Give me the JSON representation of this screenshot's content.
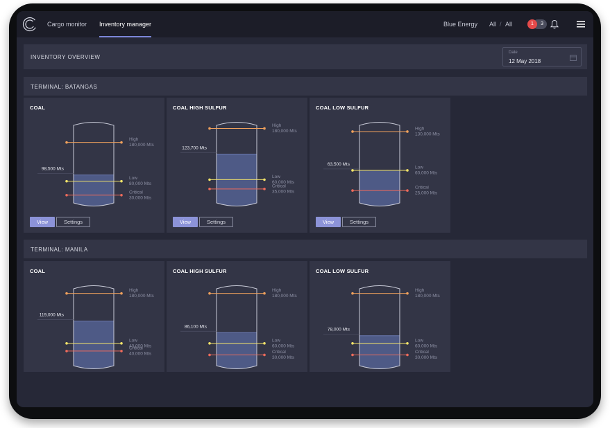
{
  "nav": {
    "tabs": [
      {
        "label": "Cargo monitor"
      },
      {
        "label": "Inventory manager"
      }
    ],
    "company": "Blue Energy",
    "filter_a": "All",
    "filter_sep": "/",
    "filter_b": "All",
    "badge_alerts": "1",
    "badge_count": "3"
  },
  "overview": {
    "title": "INVENTORY OVERVIEW",
    "date_label": "Date",
    "date_value": "12 May 2018"
  },
  "colors": {
    "accent": "#8c93d8",
    "high_line": "#f0a15c",
    "low_line": "#f3e46a",
    "critical_line": "#ee6b5b",
    "fill": "#4e5a86"
  },
  "buttons": {
    "view": "View",
    "settings": "Settings"
  },
  "terminals": [
    {
      "name": "TERMINAL: BATANGAS",
      "cards": [
        {
          "title": "COAL",
          "current": "98,500 Mts",
          "level": 0.36,
          "high_label": "High",
          "high_value": "180,000 Mts",
          "high": 0.78,
          "low_label": "Low",
          "low_value": "80,000 Mts",
          "low": 0.28,
          "critical_label": "Critical",
          "critical_value": "30,000 Mts",
          "critical": 0.1
        },
        {
          "title": "COAL HIGH SULFUR",
          "current": "123,700 Mts",
          "level": 0.63,
          "high_label": "High",
          "high_value": "180,000 Mts",
          "high": 0.96,
          "low_label": "Low",
          "low_value": "60,000 Mts",
          "low": 0.3,
          "critical_label": "Critical",
          "critical_value": "35,000 Mts",
          "critical": 0.18
        },
        {
          "title": "COAL LOW SULFUR",
          "current": "63,500 Mts",
          "level": 0.42,
          "high_label": "High",
          "high_value": "130,000 Mts",
          "high": 0.92,
          "low_label": "Low",
          "low_value": "60,000 Mts",
          "low": 0.42,
          "critical_label": "Critical",
          "critical_value": "25,000 Mts",
          "critical": 0.16
        }
      ]
    },
    {
      "name": "TERMINAL: MANILA",
      "cards": [
        {
          "title": "COAL",
          "current": "119,000 Mts",
          "level": 0.58,
          "high_label": "High",
          "high_value": "180,000 Mts",
          "high": 0.94,
          "low_label": "Low",
          "low_value": "40,000 Mts",
          "low": 0.29,
          "critical_label": "Critical",
          "critical_value": "40,000 Mts",
          "critical": 0.19
        },
        {
          "title": "COAL HIGH SULFUR",
          "current": "86,100 Mts",
          "level": 0.43,
          "high_label": "High",
          "high_value": "180,000 Mts",
          "high": 0.94,
          "low_label": "Low",
          "low_value": "60,000 Mts",
          "low": 0.29,
          "critical_label": "Critical",
          "critical_value": "30,000 Mts",
          "critical": 0.14
        },
        {
          "title": "COAL LOW SULFUR",
          "current": "78,000 Mts",
          "level": 0.39,
          "high_label": "High",
          "high_value": "180,000 Mts",
          "high": 0.94,
          "low_label": "Low",
          "low_value": "60,000 Mts",
          "low": 0.29,
          "critical_label": "Critical",
          "critical_value": "30,000 Mts",
          "critical": 0.14
        }
      ]
    }
  ]
}
